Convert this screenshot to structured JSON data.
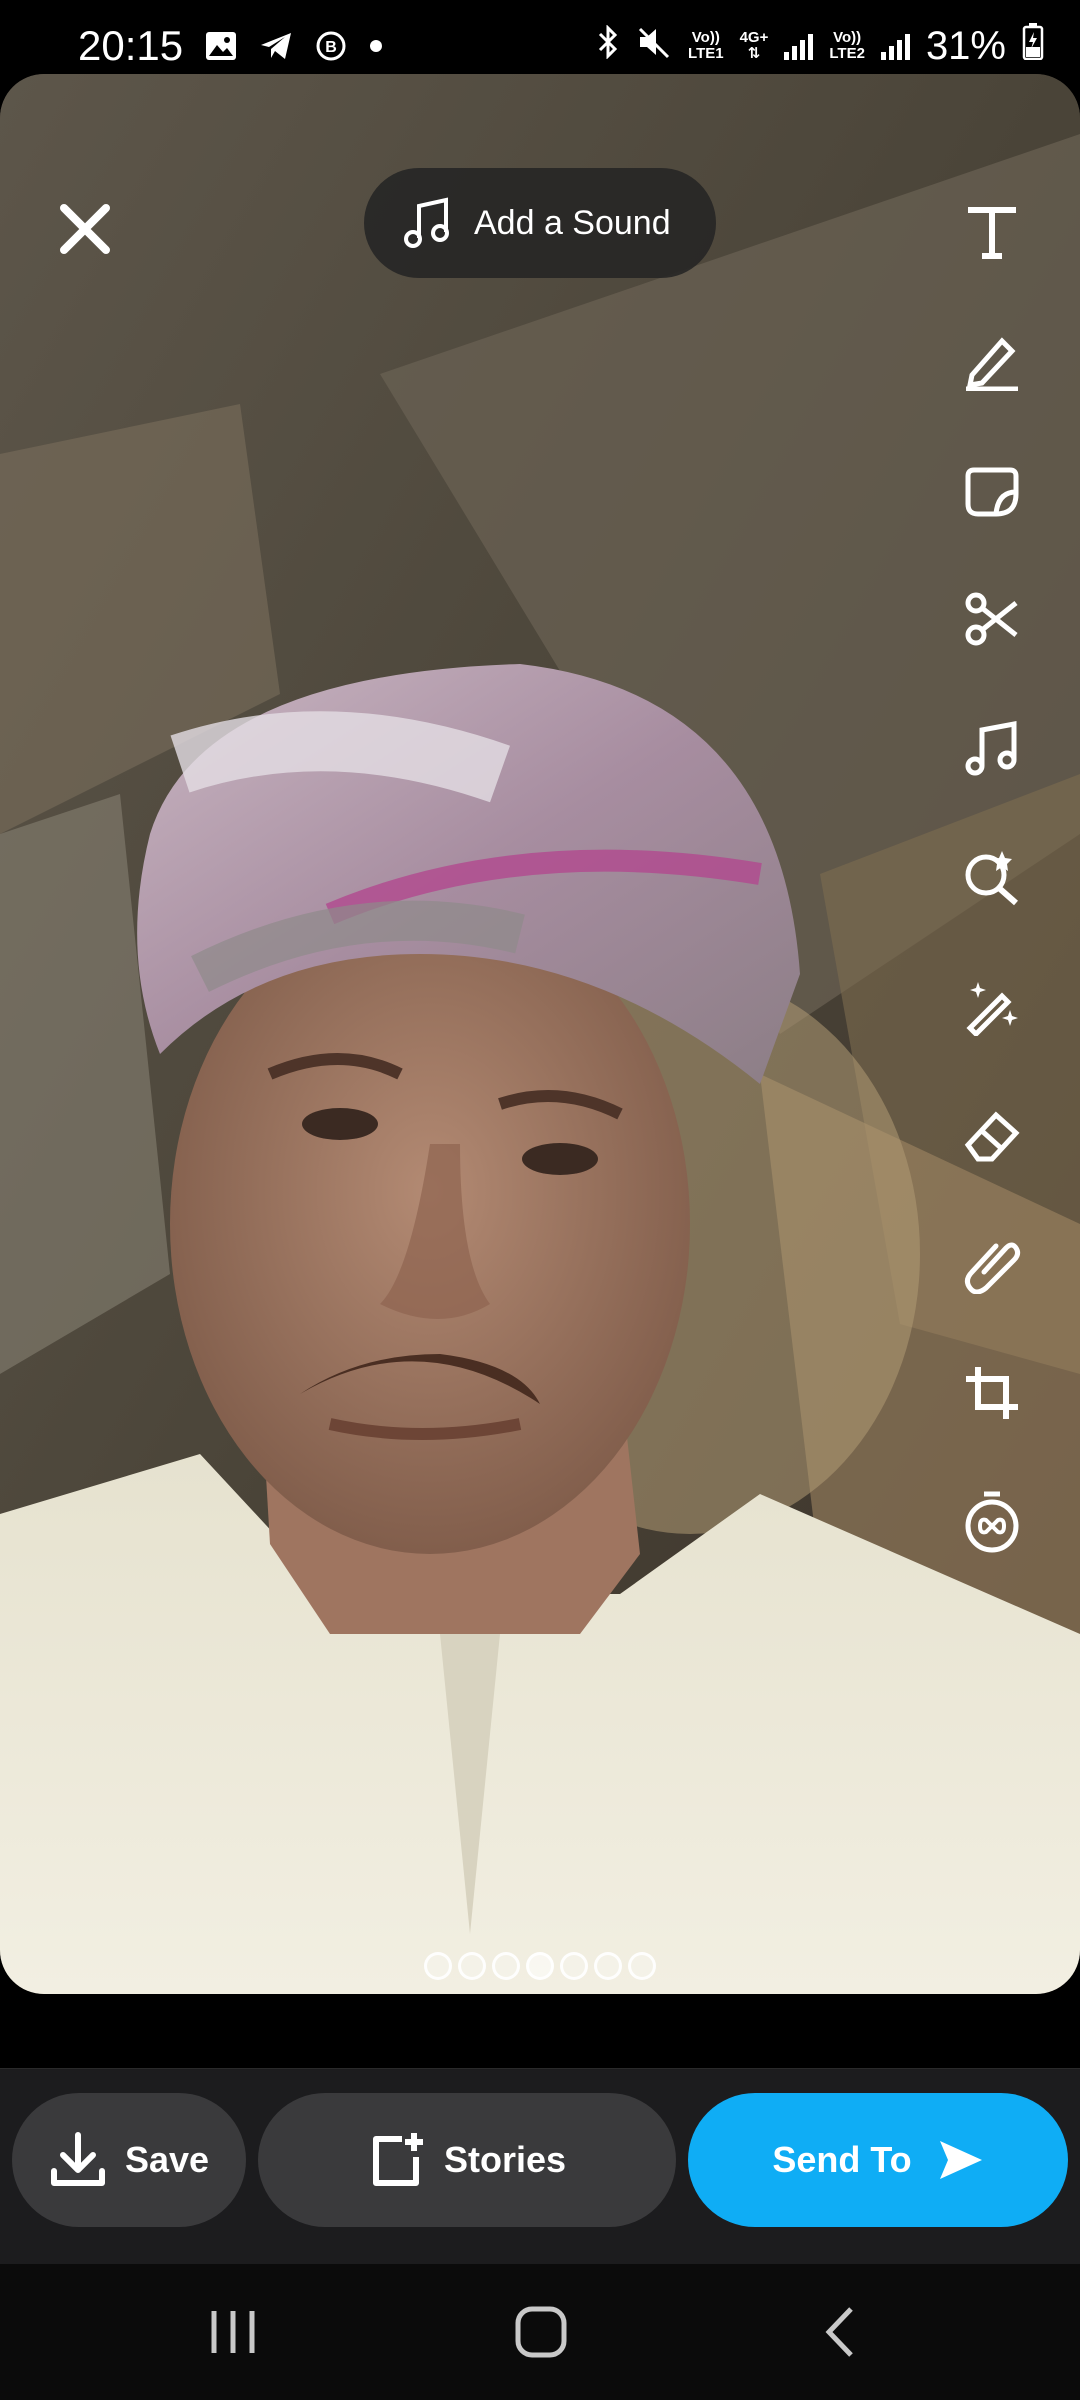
{
  "status_bar": {
    "time": "20:15",
    "notification_icons": [
      "gallery-icon",
      "telegram-icon",
      "whatsapp-business-icon",
      "more-dot-icon"
    ],
    "sim1_label_top": "Vo))",
    "sim1_label_bottom": "LTE1",
    "network_type": "4G+",
    "sim2_label_top": "Vo))",
    "sim2_label_bottom": "LTE2",
    "battery": "31%"
  },
  "editor": {
    "add_sound_label": "Add a Sound",
    "tools": [
      "text-tool-icon",
      "pencil-icon",
      "sticker-icon",
      "scissors-icon",
      "music-icon",
      "lens-search-icon",
      "magic-wand-icon",
      "eraser-icon",
      "paperclip-icon",
      "crop-icon",
      "loop-timer-icon"
    ],
    "page_dots_total": 7,
    "page_dots_active": 4
  },
  "actions": {
    "save_label": "Save",
    "stories_label": "Stories",
    "send_label": "Send To"
  },
  "colors": {
    "send_button": "#0fadf5",
    "secondary_button": "#3a3a3c",
    "action_bar": "#1c1c1e"
  }
}
